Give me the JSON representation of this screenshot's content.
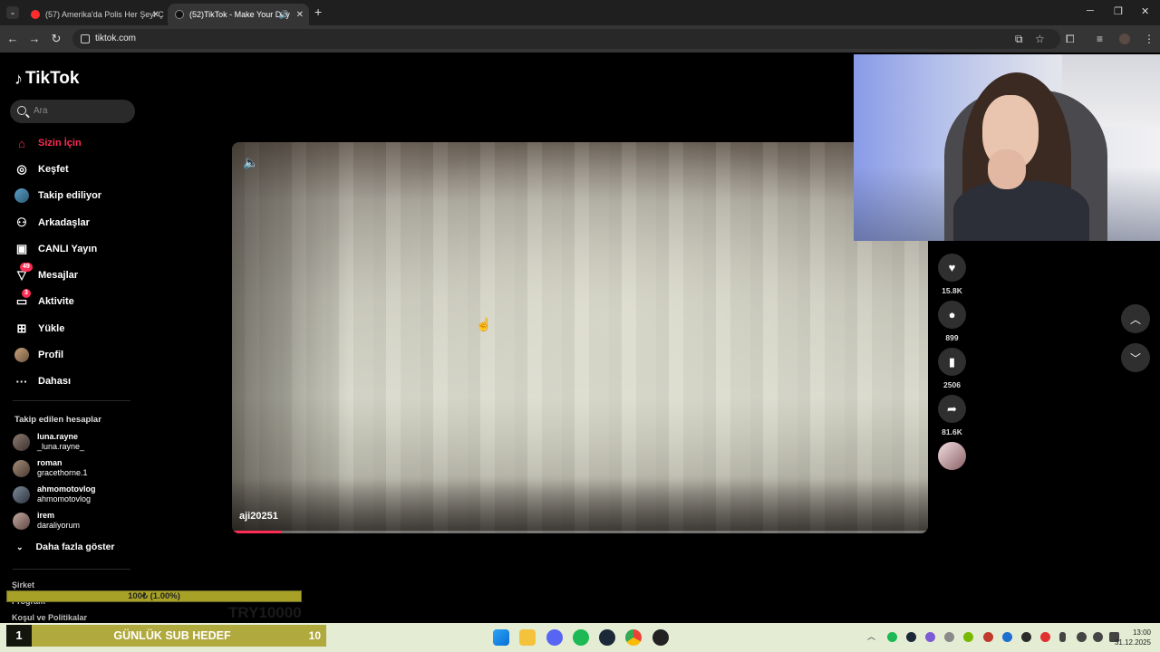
{
  "browser": {
    "tabs": [
      {
        "title": "(57) Amerika'da Polis Her Şeyi Ç",
        "active": false
      },
      {
        "title": "(52)TikTok - Make Your Day",
        "active": true
      }
    ],
    "url": "tiktok.com"
  },
  "tiktok": {
    "logo": "TikTok",
    "search_placeholder": "Ara",
    "nav": [
      {
        "label": "Sizin İçin",
        "icon": "home-icon",
        "active": true
      },
      {
        "label": "Keşfet",
        "icon": "compass-icon"
      },
      {
        "label": "Takip ediliyor",
        "icon": "following-icon"
      },
      {
        "label": "Arkadaşlar",
        "icon": "friends-icon"
      },
      {
        "label": "CANLI Yayın",
        "icon": "live-icon"
      },
      {
        "label": "Mesajlar",
        "icon": "messages-icon",
        "badge": "49"
      },
      {
        "label": "Aktivite",
        "icon": "activity-icon",
        "badge": "3"
      },
      {
        "label": "Yükle",
        "icon": "upload-icon"
      },
      {
        "label": "Profil",
        "icon": "profile-icon"
      },
      {
        "label": "Dahası",
        "icon": "more-icon"
      }
    ],
    "following_title": "Takip edilen hesaplar",
    "accounts": [
      {
        "user": "luna.rayne",
        "nick": "_luna.rayne_"
      },
      {
        "user": "roman",
        "nick": "gracethorne.1"
      },
      {
        "user": "ahmomotovlog",
        "nick": "ahmomotovlog"
      },
      {
        "user": "irem",
        "nick": "daraliyorum"
      }
    ],
    "show_more": "Daha fazla göster",
    "footer": [
      "Şirket",
      "Program",
      "Koşul ve Politikalar"
    ],
    "video": {
      "author": "aji20251",
      "progress": 0.07
    },
    "actions": {
      "likes": "15.8K",
      "comments": "899",
      "saves": "2506",
      "shares": "81.6K"
    }
  },
  "stream": {
    "goal_bar": "100₺ (1.00%)",
    "goal_ghost": "TRY10000",
    "sub_goal": {
      "count": "1",
      "label": "GÜNLÜK SUB HEDEF",
      "target": "10"
    }
  },
  "taskbar": {
    "time": "13:00",
    "date": "31.12.2025"
  },
  "colors": {
    "accent": "#fe2c55",
    "goal_bar": "#a7a227",
    "taskbar": "#e4ecd3"
  }
}
